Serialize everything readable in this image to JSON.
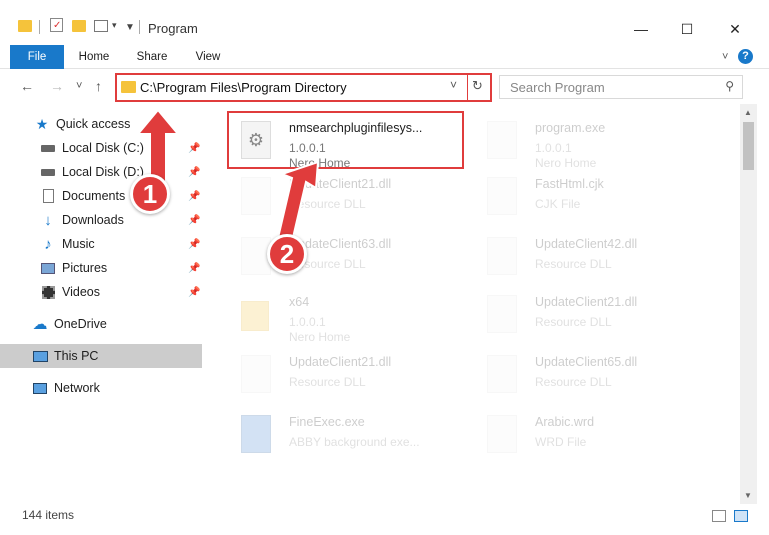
{
  "window": {
    "title": "Program",
    "min": "—",
    "max": "☐",
    "close": "✕"
  },
  "ribbon": {
    "tabs": [
      "File",
      "Home",
      "Share",
      "View"
    ],
    "help": "?"
  },
  "nav": {
    "back": "←",
    "forward": "→",
    "recent": "˅",
    "up": "↑",
    "address": "C:\\Program Files\\Program Directory",
    "search_placeholder": "Search Program"
  },
  "sidebar": {
    "items": [
      {
        "label": "Quick access",
        "icon": "star-icon",
        "pinned": false
      },
      {
        "label": "Local Disk (C:)",
        "icon": "drive-icon",
        "pinned": true
      },
      {
        "label": "Local Disk (D:)",
        "icon": "drive-icon",
        "pinned": true
      },
      {
        "label": "Documents",
        "icon": "documents-icon",
        "pinned": true
      },
      {
        "label": "Downloads",
        "icon": "downloads-icon",
        "pinned": true
      },
      {
        "label": "Music",
        "icon": "music-icon",
        "pinned": true
      },
      {
        "label": "Pictures",
        "icon": "pictures-icon",
        "pinned": true
      },
      {
        "label": "Videos",
        "icon": "videos-icon",
        "pinned": true
      },
      {
        "label": "OneDrive",
        "icon": "cloud-icon",
        "pinned": false
      },
      {
        "label": "This PC",
        "icon": "computer-icon",
        "pinned": false
      },
      {
        "label": "Network",
        "icon": "network-icon",
        "pinned": false
      }
    ]
  },
  "files": [
    {
      "name": "nmsearchpluginfilesys...",
      "line2": "1.0.0.1",
      "line3": "Nero Home",
      "highlighted": true
    },
    {
      "name": "program.exe",
      "line2": "1.0.0.1",
      "line3": "Nero Home"
    },
    {
      "name": "UpdateClient21.dll",
      "line2": "Resource DLL",
      "line3": ""
    },
    {
      "name": "FastHtml.cjk",
      "line2": "CJK File",
      "line3": ""
    },
    {
      "name": "UpdateClient63.dll",
      "line2": "Resource DLL",
      "line3": ""
    },
    {
      "name": "UpdateClient42.dll",
      "line2": "Resource DLL",
      "line3": ""
    },
    {
      "name": "x64",
      "line2": "1.0.0.1",
      "line3": "Nero Home"
    },
    {
      "name": "UpdateClient21.dll",
      "line2": "Resource DLL",
      "line3": ""
    },
    {
      "name": "UpdateClient21.dll",
      "line2": "Resource DLL",
      "line3": ""
    },
    {
      "name": "UpdateClient65.dll",
      "line2": "Resource DLL",
      "line3": ""
    },
    {
      "name": "FineExec.exe",
      "line2": "ABBY background exe...",
      "line3": ""
    },
    {
      "name": "Arabic.wrd",
      "line2": "WRD File",
      "line3": ""
    }
  ],
  "status": {
    "count": "144 items"
  },
  "annotations": {
    "step1": "1",
    "step2": "2"
  },
  "colors": {
    "accent": "#1979ca",
    "highlight": "#e03c3c"
  }
}
